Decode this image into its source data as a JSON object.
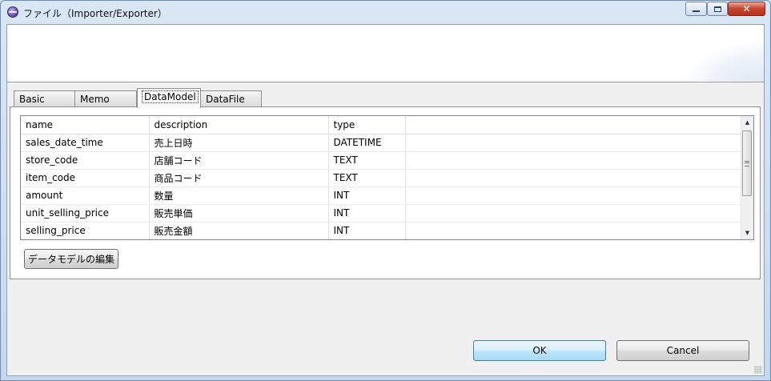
{
  "window": {
    "title": "ファイル（Importer/Exporter）"
  },
  "tabs": [
    {
      "label": "Basic"
    },
    {
      "label": "Memo"
    },
    {
      "label": "DataModel"
    },
    {
      "label": "DataFile"
    }
  ],
  "table": {
    "columns": [
      "name",
      "description",
      "type",
      ""
    ],
    "rows": [
      {
        "name": "sales_date_time",
        "description": "売上日時",
        "type": "DATETIME"
      },
      {
        "name": "store_code",
        "description": "店舗コード",
        "type": "TEXT"
      },
      {
        "name": "item_code",
        "description": "商品コード",
        "type": "TEXT"
      },
      {
        "name": "amount",
        "description": "数量",
        "type": "INT"
      },
      {
        "name": "unit_selling_price",
        "description": "販売単価",
        "type": "INT"
      },
      {
        "name": "selling_price",
        "description": "販売金額",
        "type": "INT"
      }
    ]
  },
  "buttons": {
    "edit_model": "データモデルの編集",
    "ok": "OK",
    "cancel": "Cancel"
  },
  "colors": {
    "accent": "#3c7fb1",
    "close": "#c8432c"
  }
}
